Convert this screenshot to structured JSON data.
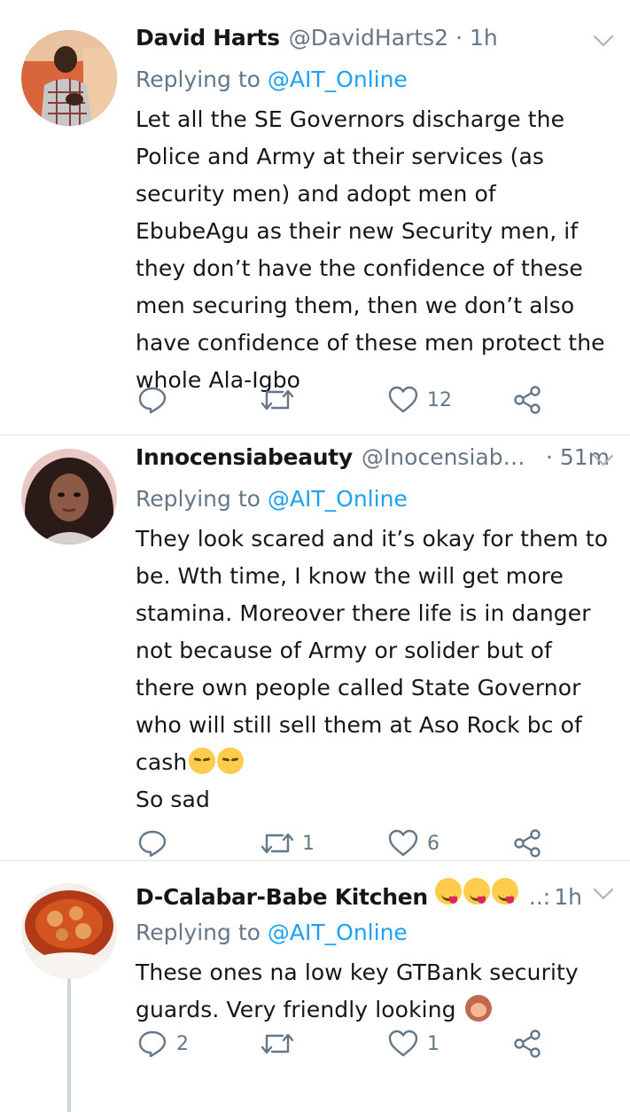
{
  "tweets": [
    {
      "name": "David Harts",
      "handle": "@DavidHarts2",
      "time": "· 1h",
      "reply_prefix": "Replying to",
      "reply_to": "@AIT_Online",
      "text": "Let all the SE Governors discharge the Police and Army at their services (as security men) and adopt men of EbubeAgu as their new Security men, if they don’t have the confidence of these men securing them, then we don’t also have confidence of these men protect the whole Ala-Igbo",
      "counts": {
        "reply": "",
        "retweet": "",
        "like": "12"
      }
    },
    {
      "name": "Innocensiabeauty",
      "handle": "@Inocensiabe…",
      "time": "· 51m",
      "reply_prefix": "Replying to",
      "reply_to": "@AIT_Online",
      "text": "They look scared and it’s okay for them to be. Wth time, I know the will get more stamina. Moreover there life is in danger not because of Army or solider but of there own people called State Governor who will still sell them at Aso Rock bc of cash",
      "text_end": "So sad",
      "counts": {
        "reply": "",
        "retweet": "1",
        "like": "6"
      }
    },
    {
      "name": "D-Calabar-Babe Kitchen",
      "handle": "..:",
      "time": "1h",
      "reply_prefix": "Replying to",
      "reply_to": "@AIT_Online",
      "text": "These ones na low key GTBank security guards. Very friendly looking",
      "counts": {
        "reply": "2",
        "retweet": "",
        "like": "1"
      }
    }
  ],
  "icons": {
    "reply": "reply-icon",
    "retweet": "retweet-icon",
    "like": "heart-icon",
    "share": "share-icon",
    "menu": "chevron-down-icon"
  },
  "colors": {
    "link": "#1da1f2",
    "secondary": "#657786",
    "divider": "#e1e8ed"
  }
}
